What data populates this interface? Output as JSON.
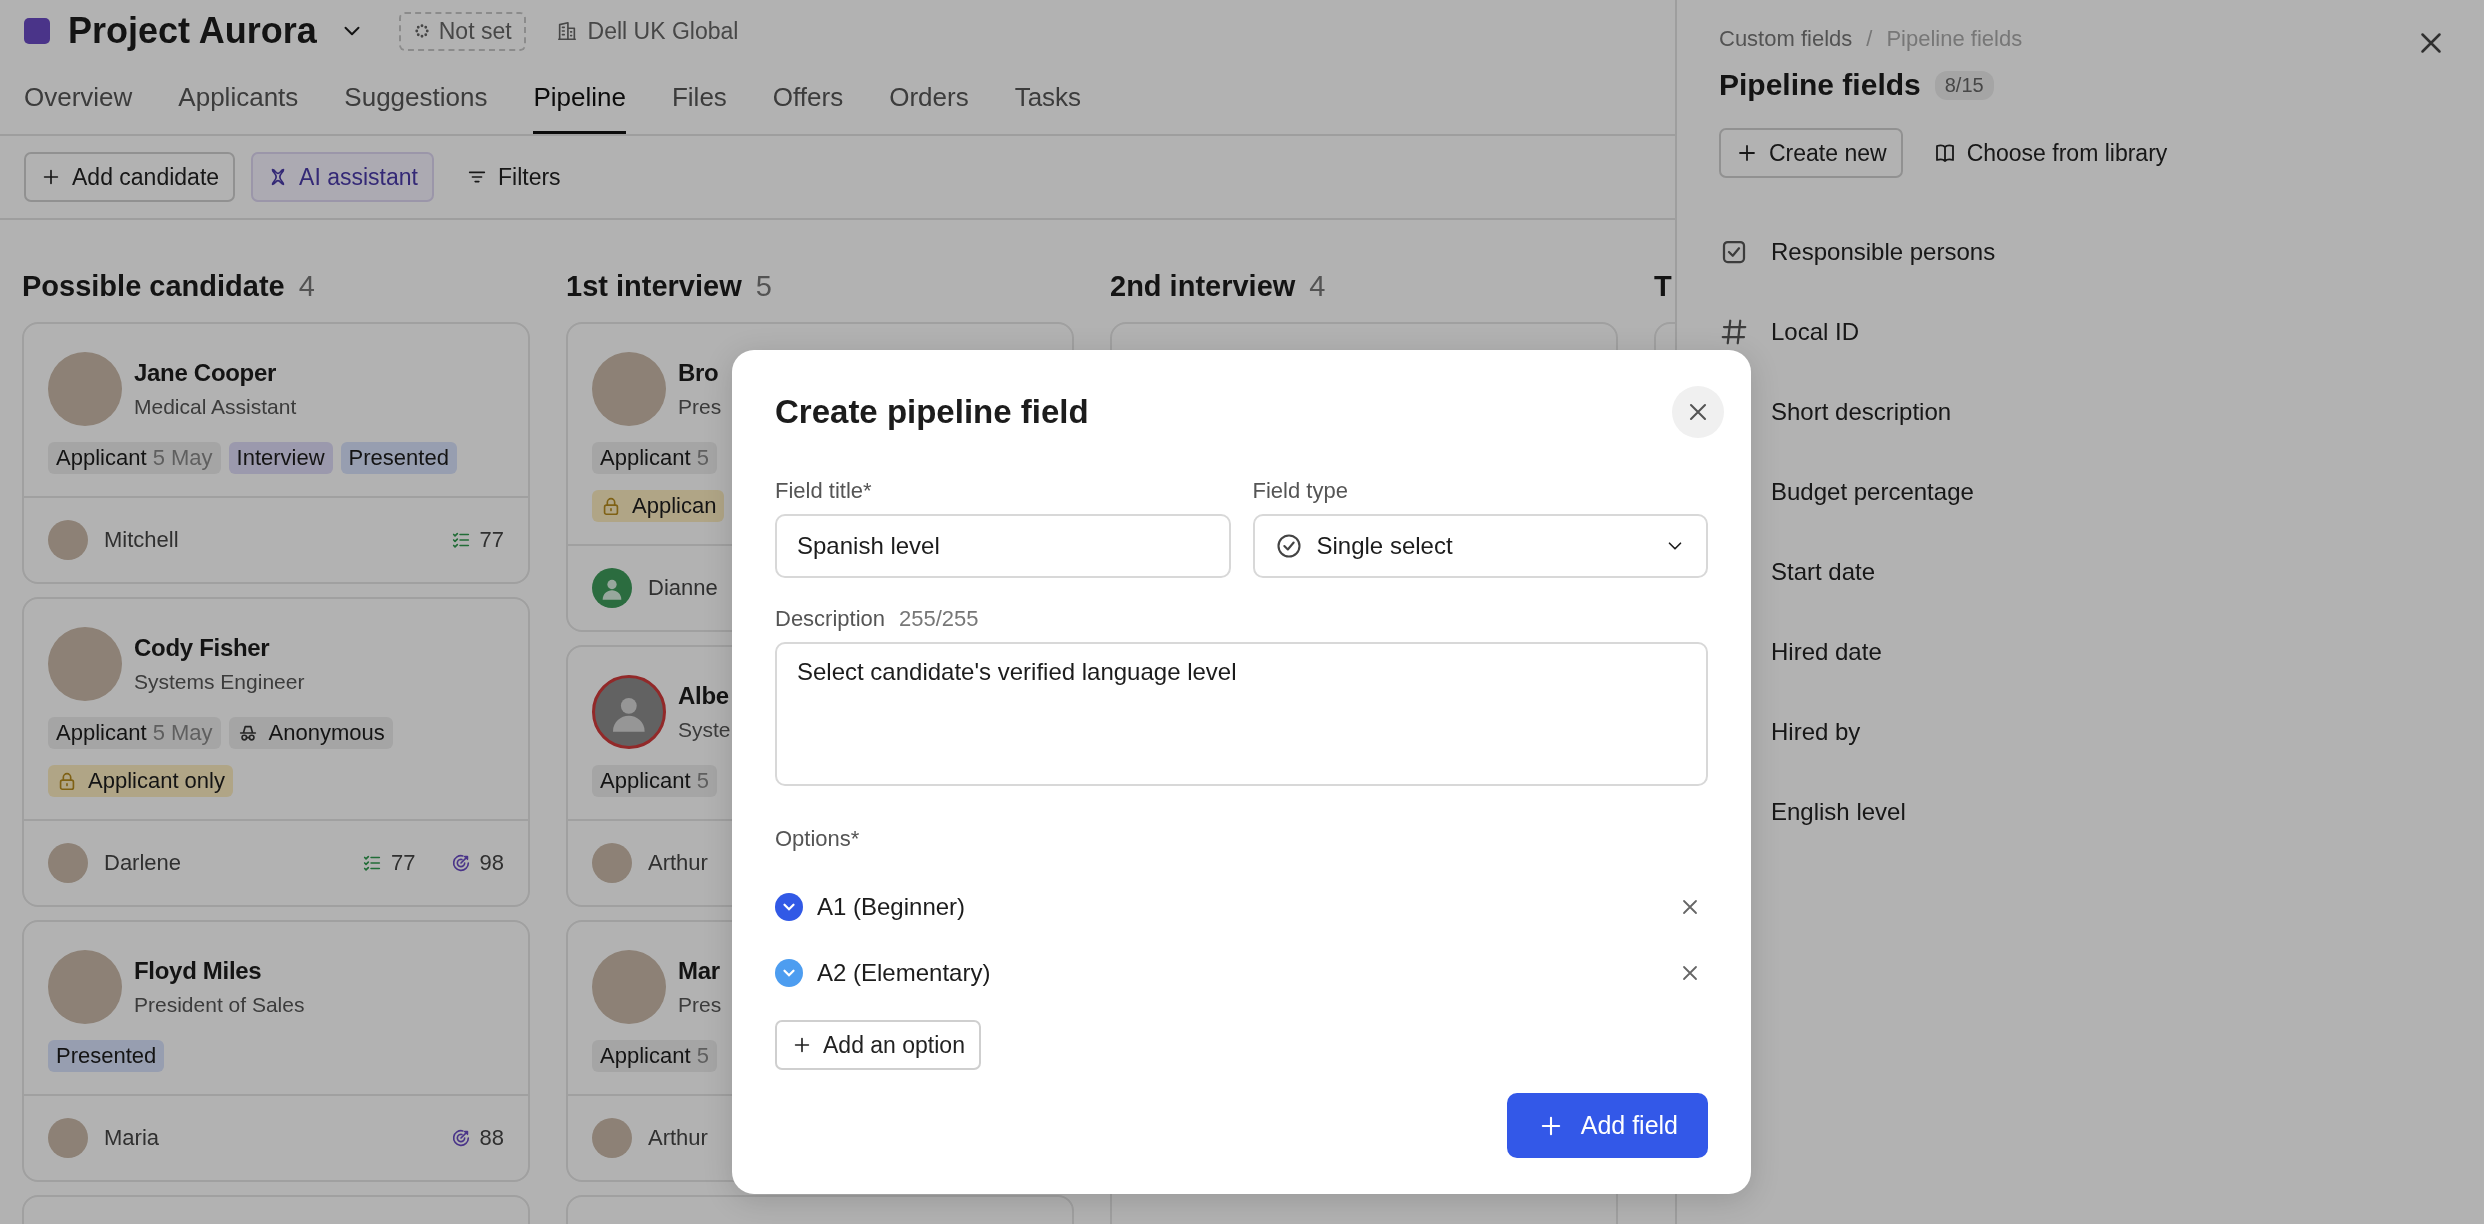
{
  "project": {
    "title": "Project Aurora",
    "status": "Not set",
    "company": "Dell UK Global"
  },
  "tabs": [
    {
      "label": "Overview",
      "selected": false
    },
    {
      "label": "Applicants",
      "selected": false
    },
    {
      "label": "Suggestions",
      "selected": false
    },
    {
      "label": "Pipeline",
      "selected": true
    },
    {
      "label": "Files",
      "selected": false
    },
    {
      "label": "Offers",
      "selected": false
    },
    {
      "label": "Orders",
      "selected": false
    },
    {
      "label": "Tasks",
      "selected": false
    }
  ],
  "toolbar": [
    {
      "kind": "add",
      "label": "Add candidate"
    },
    {
      "kind": "ai",
      "label": "AI assistant"
    },
    {
      "kind": "filter",
      "label": "Filters"
    }
  ],
  "columns": [
    {
      "title": "Possible candidate",
      "count": "4",
      "cards": [
        {
          "kind": "full",
          "name": "Jane Cooper",
          "role": "Medical Assistant",
          "avatar": {
            "kind": "photo"
          },
          "tags": [
            {
              "kind": "applicant",
              "label": "Applicant",
              "date": "5 May"
            },
            {
              "kind": "interview",
              "label": "Interview"
            },
            {
              "kind": "presented",
              "label": "Presented"
            }
          ],
          "owner": {
            "name": "Mitchell",
            "avatar": {
              "kind": "photo"
            }
          },
          "metrics": [
            {
              "kind": "tasks",
              "value": "77"
            }
          ]
        },
        {
          "kind": "full",
          "name": "Cody Fisher",
          "role": "Systems Engineer",
          "avatar": {
            "kind": "photo"
          },
          "tags": [
            {
              "kind": "applicant",
              "label": "Applicant",
              "date": "5 May"
            },
            {
              "kind": "anonymous",
              "label": "Anonymous"
            },
            {
              "kind": "restricted",
              "label": "Applicant only"
            }
          ],
          "owner": {
            "name": "Darlene",
            "avatar": {
              "kind": "photo"
            }
          },
          "metrics": [
            {
              "kind": "tasks",
              "value": "77"
            },
            {
              "kind": "score",
              "value": "98"
            }
          ]
        },
        {
          "kind": "full",
          "name": "Floyd Miles",
          "role": "President of Sales",
          "avatar": {
            "kind": "photo"
          },
          "tags": [
            {
              "kind": "presented",
              "label": "Presented"
            }
          ],
          "owner": {
            "name": "Maria",
            "avatar": {
              "kind": "photo"
            }
          },
          "metrics": [
            {
              "kind": "score",
              "value": "88"
            }
          ]
        },
        {
          "kind": "stub"
        }
      ]
    },
    {
      "title": "1st interview",
      "count": "5",
      "cards": [
        {
          "kind": "full",
          "name": "Bro",
          "role": "Pres",
          "avatar": {
            "kind": "photo"
          },
          "tags": [
            {
              "kind": "applicant",
              "label": "Applicant",
              "date": "5"
            },
            {
              "kind": "restricted",
              "label": "Applican"
            }
          ],
          "owner": {
            "name": "Dianne",
            "avatar": {
              "kind": "silhouette"
            }
          }
        },
        {
          "kind": "full",
          "name": "Albe",
          "role": "Syste",
          "avatar": {
            "kind": "alert"
          },
          "tags": [
            {
              "kind": "applicant",
              "label": "Applicant",
              "date": "5"
            }
          ],
          "owner": {
            "name": "Arthur",
            "avatar": {
              "kind": "photo"
            }
          }
        },
        {
          "kind": "full",
          "name": "Mar",
          "role": "Pres",
          "avatar": {
            "kind": "photo"
          },
          "tags": [
            {
              "kind": "applicant",
              "label": "Applicant",
              "date": "5"
            }
          ],
          "owner": {
            "name": "Arthur",
            "avatar": {
              "kind": "photo"
            }
          }
        },
        {
          "kind": "stub"
        }
      ]
    },
    {
      "title": "2nd interview",
      "count": "4",
      "cards": [
        {
          "kind": "stub"
        },
        {
          "kind": "stub"
        },
        {
          "kind": "stub"
        },
        {
          "kind": "stub"
        }
      ]
    },
    {
      "title": "T",
      "cards": [
        {
          "kind": "stub"
        }
      ]
    }
  ],
  "panel": {
    "breadcrumb": [
      "Custom fields",
      "Pipeline fields"
    ],
    "separator": "/",
    "title": "Pipeline fields",
    "count": "8/15",
    "actions": [
      {
        "kind": "create",
        "label": "Create new"
      },
      {
        "kind": "library",
        "label": "Choose from library"
      }
    ],
    "fields": [
      {
        "kind": "checkbox",
        "label": "Responsible persons"
      },
      {
        "kind": "number",
        "label": "Local ID"
      },
      {
        "kind": "plain",
        "label": "Short description"
      },
      {
        "kind": "plain",
        "label": "Budget percentage"
      },
      {
        "kind": "plain",
        "label": "Start date"
      },
      {
        "kind": "plain",
        "label": "Hired date"
      },
      {
        "kind": "plain",
        "label": "Hired by"
      },
      {
        "kind": "plain",
        "label": "English level"
      }
    ]
  },
  "dialog": {
    "title": "Create pipeline field",
    "field_title": {
      "label": "Field title*",
      "value": "Spanish level"
    },
    "field_type": {
      "label": "Field type",
      "value": "Single select"
    },
    "description": {
      "label": "Description",
      "counter": "255/255",
      "value": "Select candidate's verified language level"
    },
    "options_label": "Options*",
    "options": [
      {
        "label": "A1 (Beginner)",
        "color": "#3159e6"
      },
      {
        "label": "A2 (Elementary)",
        "color": "#4d9df0"
      }
    ],
    "add_option": "Add an option",
    "submit": "Add field"
  }
}
